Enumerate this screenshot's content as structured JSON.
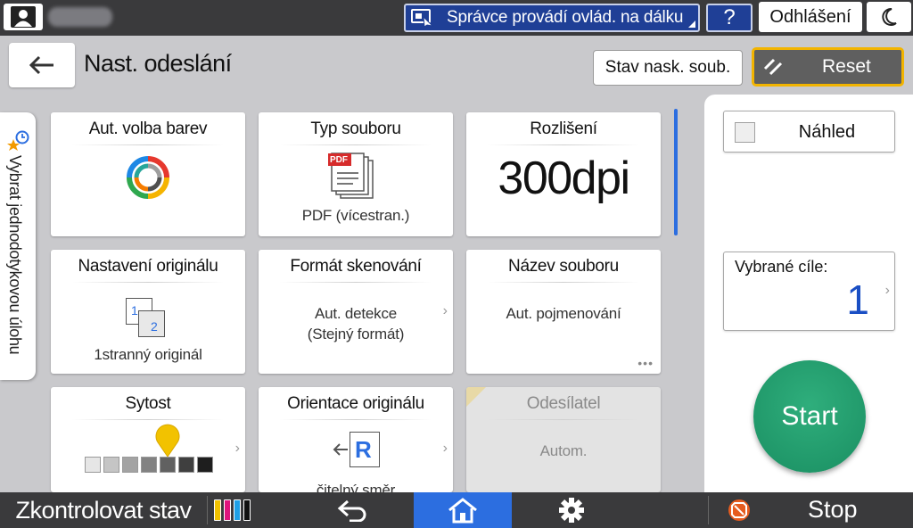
{
  "topbar": {
    "remote_label": "Správce provádí ovlád. na dálku",
    "help_label": "?",
    "logout_label": "Odhlášení"
  },
  "header": {
    "title": "Nast. odeslání",
    "job_status_label": "Stav nask. soub.",
    "reset_label": "Reset"
  },
  "side_tab": {
    "label": "Vybrat jednodotykovou úlohu"
  },
  "tiles": {
    "color": {
      "title": "Aut. volba barev"
    },
    "file_type": {
      "title": "Typ souboru",
      "value": "PDF (vícestran.)",
      "badge": "PDF"
    },
    "resolution": {
      "title": "Rozlišení",
      "value": "300dpi"
    },
    "original_settings": {
      "title": "Nastavení originálu",
      "value": "1stranný originál",
      "page1": "1",
      "page2": "2"
    },
    "scan_format": {
      "title": "Formát skenování",
      "value_line1": "Aut. detekce",
      "value_line2": "(Stejný formát)"
    },
    "file_name": {
      "title": "Název souboru",
      "value": "Aut. pojmenování"
    },
    "density": {
      "title": "Sytost",
      "level": 5,
      "steps": 7
    },
    "orientation": {
      "title": "Orientace originálu",
      "value": "čitelný směr",
      "letter": "R"
    },
    "sender": {
      "title": "Odesílatel",
      "value": "Autom."
    }
  },
  "right_panel": {
    "preview_label": "Náhled",
    "destinations_label": "Vybrané cíle:",
    "destinations_count": "1",
    "start_label": "Start"
  },
  "bottombar": {
    "status_label": "Zkontrolovat stav",
    "stop_label": "Stop"
  },
  "colors": {
    "accent_blue": "#2c6ee0",
    "remote_blue": "#1f3f96",
    "start_green": "#1a8f62",
    "reset_border": "#f2b400",
    "density_marker": "#f2c200",
    "toner": [
      "#f2c200",
      "#e0147c",
      "#1ea0e6",
      "#111111"
    ]
  }
}
